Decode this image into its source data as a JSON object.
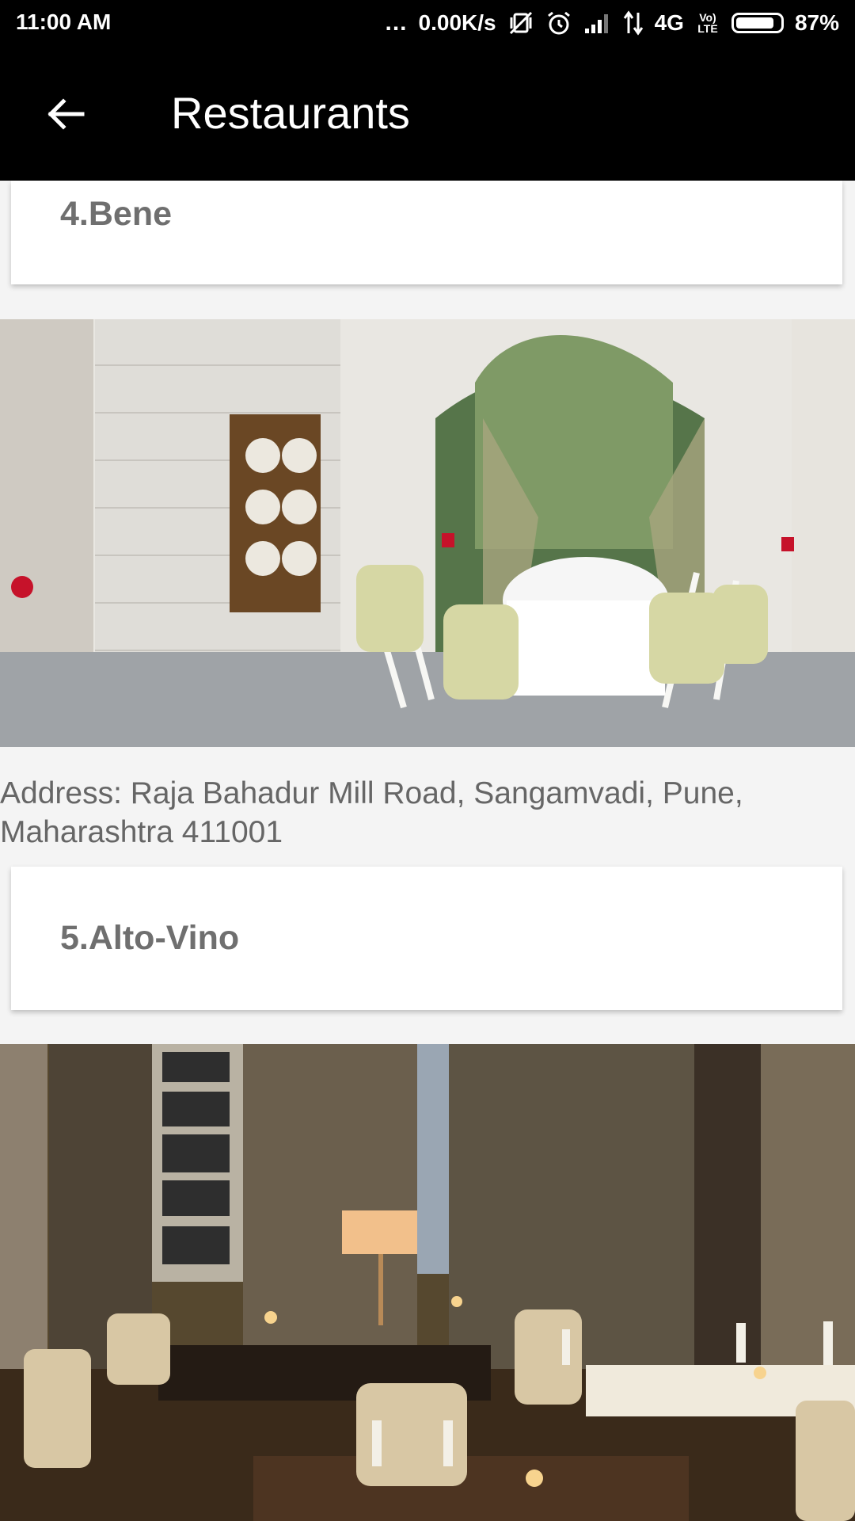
{
  "status_bar": {
    "time": "11:00 AM",
    "dots": "...",
    "network_speed": "0.00K/s",
    "network_type": "4G",
    "carrier_label": "Vo) LTE",
    "battery_percent": "87%",
    "battery_level": 0.87,
    "icons": [
      "more-dots-icon",
      "vibrate-off-icon",
      "alarm-icon",
      "signal-icon",
      "data-arrows-icon",
      "volte-icon",
      "battery-icon"
    ]
  },
  "toolbar": {
    "title": "Restaurants",
    "back_icon": "arrow-left-icon"
  },
  "restaurants": [
    {
      "title": "4.Bene",
      "photo": "bene-dining-room-photo",
      "address": "Address: Raja Bahadur Mill Road, Sangamvadi, Pune, Maharashtra 411001"
    },
    {
      "title": "5.Alto-Vino",
      "photo": "alto-vino-restaurant-photo"
    }
  ],
  "colors": {
    "app_bar": "#000000",
    "page_background": "#f4f4f4",
    "card_background": "#ffffff",
    "title_text": "#6f6f6f",
    "address_text": "#666666"
  }
}
